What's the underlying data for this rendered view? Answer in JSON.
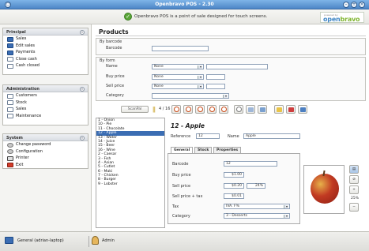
{
  "window": {
    "title": "Openbravo POS - 2.30"
  },
  "banner": {
    "message": "Openbravo POS is a point of sale designed for touch screens.",
    "logo_small": "powered by",
    "logo_open": "open",
    "logo_bravo": "bravo"
  },
  "sidebar": {
    "principal": {
      "title": "Principal",
      "items": [
        {
          "label": "Sales",
          "icon": "sales-icon"
        },
        {
          "label": "Edit sales",
          "icon": "edit-sales-icon"
        },
        {
          "label": "Payments",
          "icon": "payments-icon"
        },
        {
          "label": "Close cash",
          "icon": "close-cash-icon"
        },
        {
          "label": "Cash closed",
          "icon": "cash-closed-icon"
        }
      ]
    },
    "administration": {
      "title": "Administration",
      "items": [
        {
          "label": "Customers",
          "icon": "customers-icon"
        },
        {
          "label": "Stock",
          "icon": "stock-icon"
        },
        {
          "label": "Sales",
          "icon": "sales-report-icon"
        },
        {
          "label": "Maintenance",
          "icon": "maintenance-icon"
        }
      ]
    },
    "system": {
      "title": "System",
      "items": [
        {
          "label": "Change password",
          "icon": "key-icon"
        },
        {
          "label": "Configuration",
          "icon": "configuration-icon"
        },
        {
          "label": "Printer",
          "icon": "printer-icon"
        },
        {
          "label": "Exit",
          "icon": "exit-icon"
        }
      ]
    }
  },
  "products": {
    "title": "Products",
    "barcode_section": "By barcode",
    "barcode_label": "Barcode",
    "form_section": "By form",
    "name_label": "Name",
    "name_op": "None",
    "buy_label": "Buy price",
    "buy_op": "None",
    "sell_label": "Sell price",
    "sell_op": "None",
    "category_label": "Category",
    "category_value": ""
  },
  "toolbar": {
    "scan_label": "ScanPal",
    "counter": "4 / 16"
  },
  "list": [
    "1 - Onion",
    "10 - Pie",
    "11 - Chocolate",
    "12 - Apple",
    "13 - Water",
    "14 - Juice",
    "15 - Beer",
    "16 - Wine",
    "2 - Caesar",
    "3 - Fish",
    "4 - Asian",
    "5 - Cutlet",
    "6 - Maki",
    "7 - Chicken",
    "8 - Burger",
    "9 - Lobster"
  ],
  "list_selected": 3,
  "detail": {
    "heading": "12 - Apple",
    "reference_label": "Reference",
    "reference_value": "12",
    "name_label": "Name",
    "name_value": "Apple",
    "tabs": [
      "General",
      "Stock",
      "Properties"
    ],
    "barcode_label": "Barcode",
    "barcode_value": "12",
    "buy_label": "Buy price",
    "buy_value": "$1.00",
    "sell_label": "Sell price",
    "sell_value": "$0.20",
    "margin_value": "24%",
    "sell_tax_label": "Sell price + tax",
    "sell_tax_value": "$0.01",
    "tax_label": "Tax",
    "tax_value": "IVA. F%",
    "category_label": "Category",
    "category_value": "3 - Desserts",
    "zoom_value": "25%"
  },
  "status": {
    "host": "General (adrian-laptop)",
    "user": "Admin"
  }
}
